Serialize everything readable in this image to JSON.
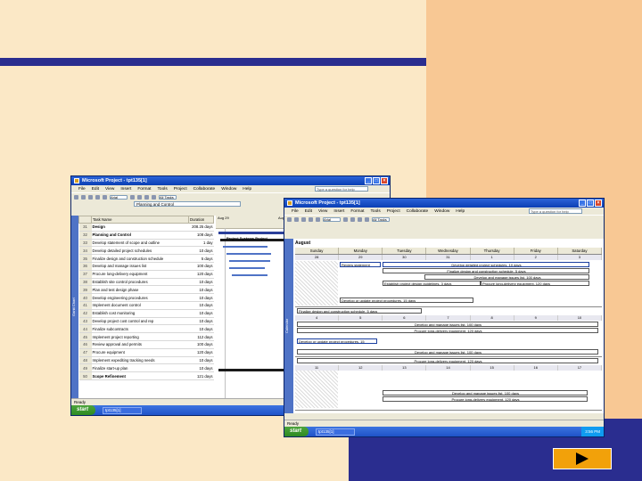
{
  "colors": {
    "slide_bg": "#fbe8c6",
    "panel": "#f8c894",
    "navy": "#2a2d8f",
    "next": "#f2a10a"
  },
  "back_window": {
    "title": "Microsoft Project - tpt135[1]",
    "menu": [
      "File",
      "Edit",
      "View",
      "Insert",
      "Format",
      "Tools",
      "Project",
      "Collaborate",
      "Window",
      "Help"
    ],
    "ask": "Type a question for help",
    "font_box": "Arial",
    "view_box": "All Tasks",
    "entry": "Planning and Control",
    "side_label": "Gantt Chart",
    "col_name": "Task Name",
    "col_duration": "Duration",
    "gantt_head1": "Aug 29",
    "gantt_head2": "Aug 27",
    "gantt_label": "Project Systems Project",
    "rows": [
      {
        "id": "31",
        "name": "Design",
        "dur": "208.25 days",
        "bold": true
      },
      {
        "id": "32",
        "name": "Planning and Control",
        "dur": "108 days",
        "bold": true
      },
      {
        "id": "33",
        "name": "Develop statement of scope and outline",
        "dur": "1 day",
        "bold": false
      },
      {
        "id": "34",
        "name": "Develop detailed project schedules",
        "dur": "10 days",
        "bold": false
      },
      {
        "id": "35",
        "name": "Finalize design and construction schedule",
        "dur": "5 days",
        "bold": false
      },
      {
        "id": "36",
        "name": "Develop and manage issues list",
        "dur": "100 days",
        "bold": false
      },
      {
        "id": "37",
        "name": "Procure long-delivery equipment",
        "dur": "120 days",
        "bold": false
      },
      {
        "id": "38",
        "name": "Establish site control procedures",
        "dur": "10 days",
        "bold": false
      },
      {
        "id": "39",
        "name": "Plan and test design phase",
        "dur": "10 days",
        "bold": false
      },
      {
        "id": "40",
        "name": "Develop engineering procedures",
        "dur": "10 days",
        "bold": false
      },
      {
        "id": "41",
        "name": "Implement document control",
        "dur": "10 days",
        "bold": false
      },
      {
        "id": "42",
        "name": "Establish cost monitoring",
        "dur": "10 days",
        "bold": false
      },
      {
        "id": "43",
        "name": "Develop project cost control and rep",
        "dur": "10 days",
        "bold": false
      },
      {
        "id": "44",
        "name": "Finalize subcontracts",
        "dur": "10 days",
        "bold": false
      },
      {
        "id": "45",
        "name": "Implement project reporting",
        "dur": "112 days",
        "bold": false
      },
      {
        "id": "46",
        "name": "Review approval and permits",
        "dur": "100 days",
        "bold": false
      },
      {
        "id": "47",
        "name": "Procure equipment",
        "dur": "120 days",
        "bold": false
      },
      {
        "id": "48",
        "name": "Implement expediting tracking needs",
        "dur": "10 days",
        "bold": false
      },
      {
        "id": "49",
        "name": "Finalize start-up plan",
        "dur": "10 days",
        "bold": false
      },
      {
        "id": "50",
        "name": "Scope Refinement",
        "dur": "121 days",
        "bold": true
      }
    ],
    "status": "Ready",
    "start": "start",
    "task_item": "tpt135[1]",
    "clock": "3:56 PM"
  },
  "front_window": {
    "title": "Microsoft Project - tpt135[1]",
    "menu": [
      "File",
      "Edit",
      "View",
      "Insert",
      "Format",
      "Tools",
      "Project",
      "Collaborate",
      "Window",
      "Help"
    ],
    "ask": "Type a question for help",
    "font_box": "Arial",
    "view_box": "All Tasks",
    "side_label": "Calendar",
    "month": "August",
    "days": [
      "Sunday",
      "Monday",
      "Tuesday",
      "Wednesday",
      "Thursday",
      "Friday",
      "Saturday"
    ],
    "week1": [
      "28",
      "29",
      "30",
      "31",
      "1",
      "2",
      "3"
    ],
    "week2": [
      "4",
      "5",
      "6",
      "7",
      "8",
      "9",
      "10"
    ],
    "week3": [
      "11",
      "12",
      "13",
      "14",
      "15",
      "16",
      "17"
    ],
    "events": {
      "e1": "Review statement",
      "e2": "Develop detailed project schedules, 10 days",
      "e3": "Finalize design and construction schedule, 5 days",
      "e4": "Develop and manage issues list, 100 days",
      "e5": "Establish project design guidelines, 3 days",
      "e6": "Procure long-delivery equipment, 120 days",
      "e7": "Develop or update project procedures, 15 days",
      "e8": "Finalize design and construction schedule, 5 days",
      "e9": "Develop and manage issues list, 100 days",
      "e10": "Procure long-delivery equipment, 120 days",
      "e11": "Develop or update project procedures, 15",
      "e12": "Develop and manage issues list, 100 days",
      "e13": "Procure long-delivery equipment, 120 days",
      "e14": "Develop and manage issues list, 100 days",
      "e15": "Procure long-delivery equipment, 120 days"
    },
    "status": "Ready",
    "start": "start",
    "task_item": "tpt135[1]",
    "clock": "3:56 PM"
  }
}
